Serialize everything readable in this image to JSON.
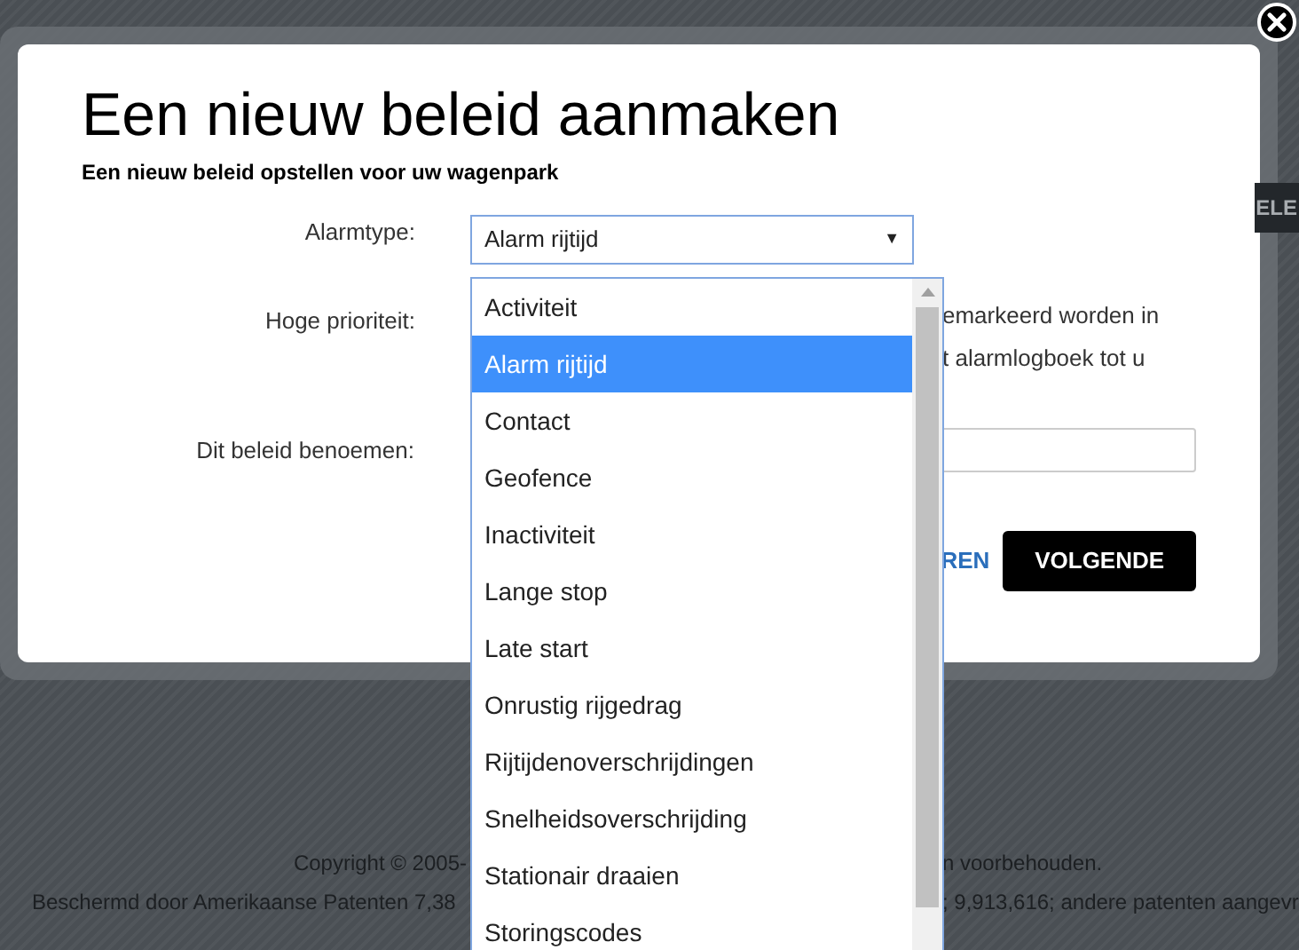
{
  "background": {
    "button_fragment": "ELE",
    "footer_left": [
      "Copyright © 2005-",
      "Beschermd door Amerikaanse Patenten 7,38"
    ],
    "footer_right": [
      "n voorbehouden.",
      "; 9,913,616; andere patenten aangevr"
    ]
  },
  "dialog": {
    "title": "Een nieuw beleid aanmaken",
    "subtitle": "Een nieuw beleid opstellen voor uw wagenpark",
    "alarm_type": {
      "label": "Alarmtype:",
      "value": "Alarm rijtijd",
      "caret": "▼",
      "options": [
        {
          "label": "Activiteit",
          "selected": false
        },
        {
          "label": "Alarm rijtijd",
          "selected": true
        },
        {
          "label": "Contact",
          "selected": false
        },
        {
          "label": "Geofence",
          "selected": false
        },
        {
          "label": "Inactiviteit",
          "selected": false
        },
        {
          "label": "Lange stop",
          "selected": false
        },
        {
          "label": "Late start",
          "selected": false
        },
        {
          "label": "Onrustig rijgedrag",
          "selected": false
        },
        {
          "label": "Rijtijdenoverschrijdingen",
          "selected": false
        },
        {
          "label": "Snelheidsoverschrijding",
          "selected": false
        },
        {
          "label": "Stationair draaien",
          "selected": false
        },
        {
          "label": "Storingscodes",
          "selected": false
        }
      ]
    },
    "high_priority": {
      "label": "Hoge prioriteit:",
      "description_lines": [
        "emarkeerd worden in",
        "t alarmlogboek tot u"
      ]
    },
    "name": {
      "label": "Dit beleid benoemen:"
    },
    "cancel_fragment": "REN",
    "next_button": "VOLGENDE"
  }
}
